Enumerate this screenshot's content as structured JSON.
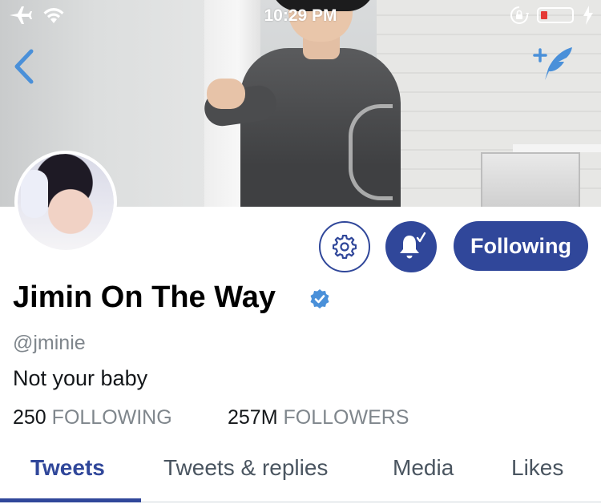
{
  "status_bar": {
    "time": "10:29 PM",
    "icons": [
      "airplane-icon",
      "wifi-icon",
      "orientation-lock-icon",
      "battery-icon",
      "charging-bolt-icon"
    ],
    "battery_color": "#e53935"
  },
  "header": {
    "back_icon": "chevron-left-icon",
    "compose_icon": "compose-tweet-icon",
    "accent": "#4a90d9"
  },
  "profile": {
    "display_name": "Jimin On The Way",
    "verified": true,
    "handle": "@jminie",
    "bio": "Not your baby",
    "following_count": "250",
    "following_label": "FOLLOWING",
    "followers_count": "257M",
    "followers_label": "FOLLOWERS"
  },
  "actions": {
    "settings_icon": "gear-icon",
    "notify_icon": "bell-check-icon",
    "follow_button_label": "Following",
    "brand_color": "#30479a"
  },
  "tabs": [
    {
      "label": "Tweets",
      "active": true
    },
    {
      "label": "Tweets & replies",
      "active": false
    },
    {
      "label": "Media",
      "active": false
    },
    {
      "label": "Likes",
      "active": false
    }
  ]
}
